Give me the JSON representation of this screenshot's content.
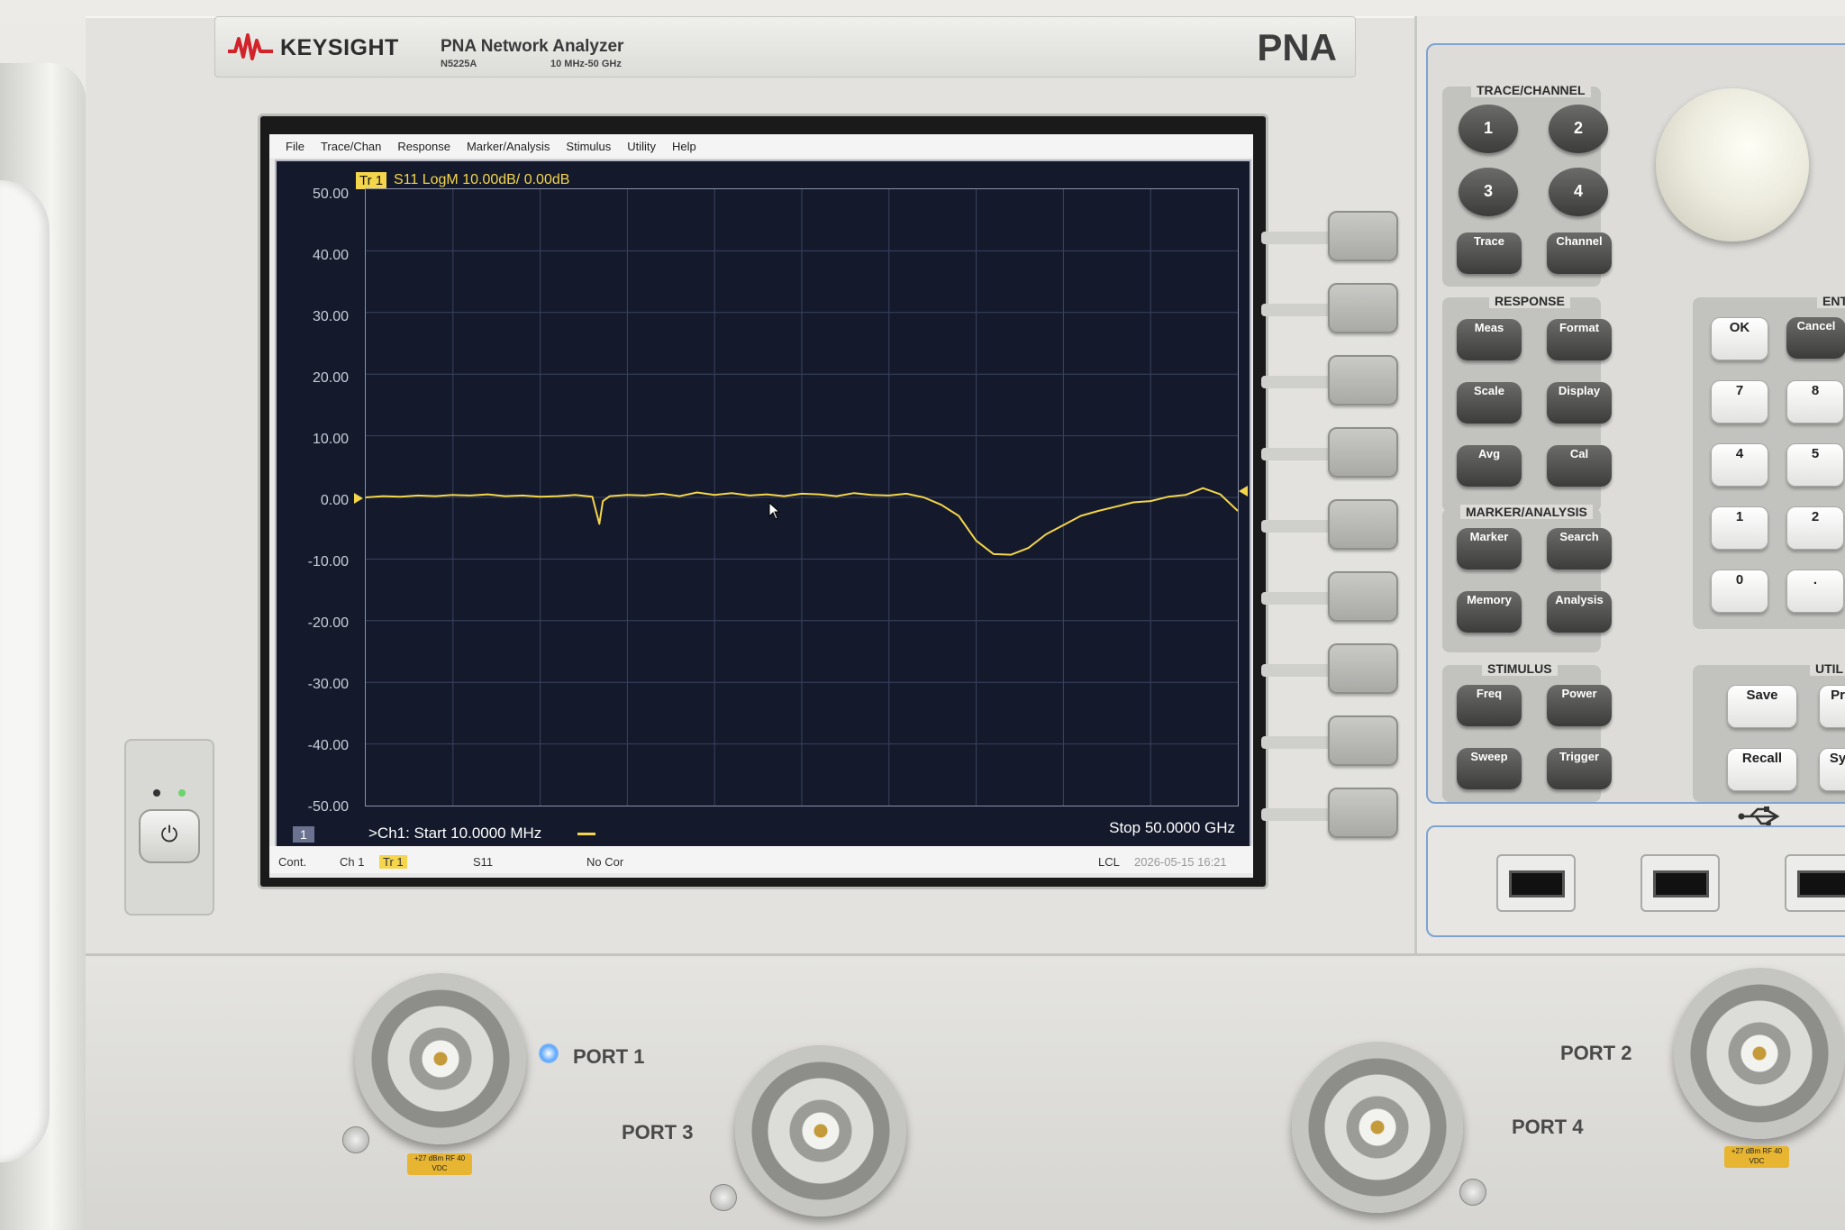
{
  "header": {
    "brand": "KEYSIGHT",
    "product": "PNA Network Analyzer",
    "model": "N5225A",
    "freq_range": "10 MHz-50 GHz",
    "badge": "PNA"
  },
  "menu": [
    "File",
    "Trace/Chan",
    "Response",
    "Marker/Analysis",
    "Stimulus",
    "Utility",
    "Help"
  ],
  "plot": {
    "trace_tag": "Tr 1",
    "trace_desc": "S11 LogM 10.00dB/  0.00dB",
    "channel": "1",
    "start": ">Ch1:  Start  10.0000 MHz",
    "stop": "Stop  50.0000 GHz",
    "trace_color": "#f4d54b"
  },
  "status": {
    "cont": "Cont.",
    "ch": "Ch 1",
    "tr": "Tr 1",
    "param": "S11",
    "cor": "No Cor",
    "lcl": "LCL",
    "datetime": "2026-05-15 16:21"
  },
  "chart_data": {
    "type": "line",
    "title": "S11 LogM 10.00dB/  0.00dB",
    "xlabel": "",
    "ylabel": "",
    "xlim": [
      0.01,
      50
    ],
    "ylim": [
      -50,
      50
    ],
    "yticks": [
      "50.00",
      "40.00",
      "30.00",
      "20.00",
      "10.00",
      "0.00",
      "-10.00",
      "-20.00",
      "-30.00",
      "-40.00",
      "-50.00"
    ],
    "grid": true,
    "series": [
      {
        "x": [
          0.01,
          1,
          2,
          3,
          4,
          5,
          6,
          7,
          8,
          9,
          10,
          11,
          12,
          13,
          13.4,
          13.6,
          14,
          15,
          16,
          17,
          18,
          19,
          20,
          21,
          22,
          23,
          24,
          25,
          26,
          27,
          28,
          29,
          30,
          31,
          32,
          33,
          34,
          35,
          36,
          37,
          38,
          39,
          40,
          41,
          42,
          43,
          44,
          45,
          46,
          47,
          48,
          49,
          50
        ],
        "y": [
          0,
          0.2,
          0.1,
          0.3,
          0.2,
          0.4,
          0.3,
          0.5,
          0.2,
          0.3,
          0.1,
          0.2,
          0.4,
          0.1,
          -4.3,
          -0.6,
          0.2,
          0.4,
          0.3,
          0.6,
          0.2,
          0.8,
          0.4,
          0.7,
          0.3,
          0.5,
          0.2,
          0.6,
          0.5,
          0.2,
          0.7,
          0.4,
          0.3,
          0.6,
          0.0,
          -1.2,
          -3.0,
          -7.0,
          -9.2,
          -9.3,
          -8.2,
          -6.0,
          -4.5,
          -3.0,
          -2.2,
          -1.5,
          -0.8,
          -0.6,
          0.1,
          0.4,
          1.5,
          0.5,
          -2.2
        ]
      }
    ]
  },
  "softkeys": 9,
  "keys": {
    "trace_channel": {
      "title": "TRACE/CHANNEL",
      "buttons": [
        "1",
        "2",
        "3",
        "4",
        "Trace",
        "Channel"
      ]
    },
    "response": {
      "title": "RESPONSE",
      "buttons": [
        "Meas",
        "Format",
        "Scale",
        "Display",
        "Avg",
        "Cal"
      ]
    },
    "marker_analysis": {
      "title": "MARKER/ANALYSIS",
      "buttons": [
        "Marker",
        "Search",
        "Memory",
        "Analysis"
      ]
    },
    "stimulus": {
      "title": "STIMULUS",
      "buttons": [
        "Freq",
        "Power",
        "Sweep",
        "Trigger"
      ]
    },
    "entry": {
      "title": "ENT",
      "buttons": [
        "OK",
        "Cancel",
        "7",
        "8",
        "4",
        "5",
        "1",
        "2",
        "0",
        "."
      ]
    },
    "utility": {
      "title": "UTIL",
      "buttons": [
        "Save",
        "Pr",
        "Recall",
        "Sy"
      ]
    }
  },
  "ports": {
    "port1": "PORT 1",
    "port2": "PORT 2",
    "port3": "PORT 3",
    "port4": "PORT 4",
    "warning": "+27 dBm RF 40 VDC"
  }
}
